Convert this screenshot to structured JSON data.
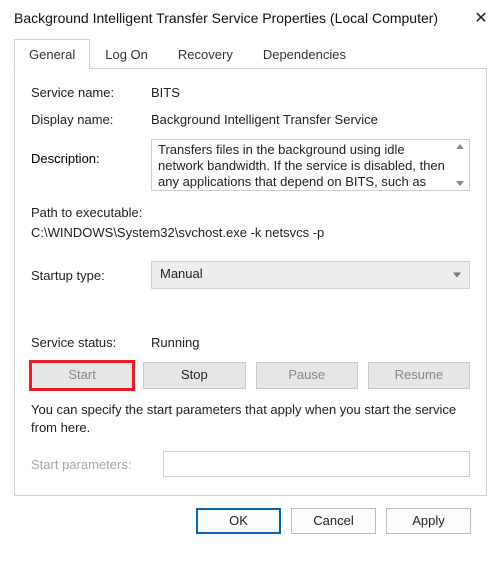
{
  "window": {
    "title": "Background Intelligent Transfer Service Properties (Local Computer)"
  },
  "tabs": {
    "general": "General",
    "logon": "Log On",
    "recovery": "Recovery",
    "dependencies": "Dependencies"
  },
  "labels": {
    "service_name": "Service name:",
    "display_name": "Display name:",
    "description": "Description:",
    "path": "Path to executable:",
    "startup_type": "Startup type:",
    "service_status": "Service status:",
    "start_parameters": "Start parameters:"
  },
  "values": {
    "service_name": "BITS",
    "display_name": "Background Intelligent Transfer Service",
    "description": "Transfers files in the background using idle network bandwidth. If the service is disabled, then any applications that depend on BITS, such as Windows",
    "path": "C:\\WINDOWS\\System32\\svchost.exe -k netsvcs -p",
    "startup_type": "Manual",
    "service_status": "Running",
    "start_parameters": ""
  },
  "buttons": {
    "start": "Start",
    "stop": "Stop",
    "pause": "Pause",
    "resume": "Resume",
    "ok": "OK",
    "cancel": "Cancel",
    "apply": "Apply"
  },
  "hint": "You can specify the start parameters that apply when you start the service from here."
}
